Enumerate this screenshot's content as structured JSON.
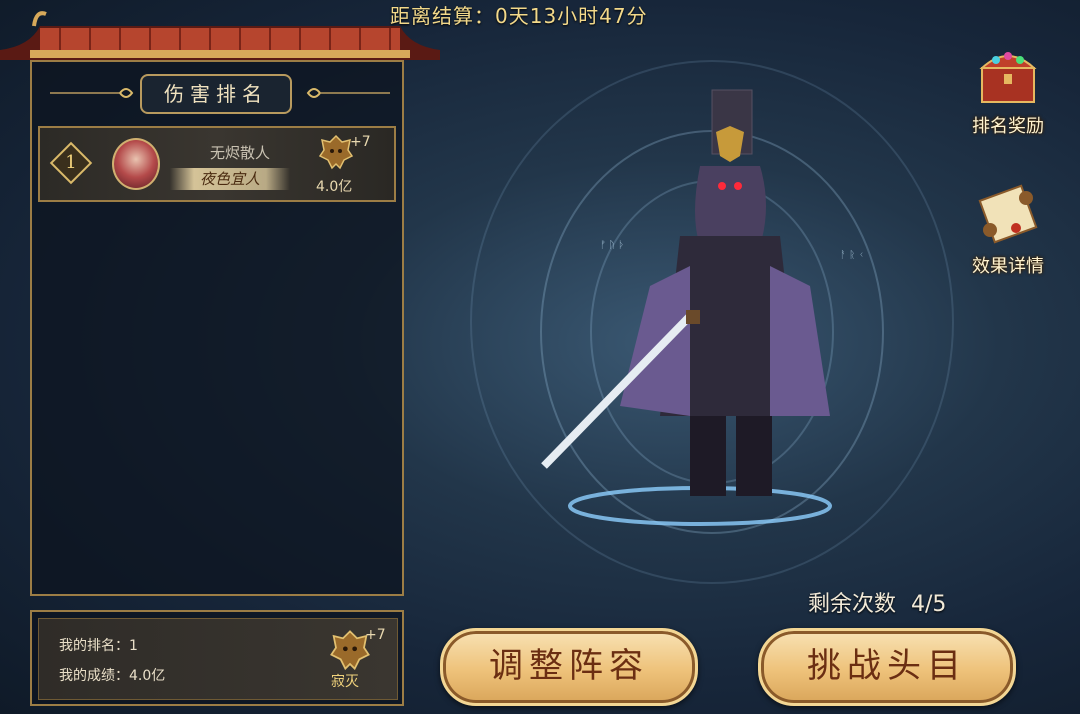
{
  "header": {
    "countdown": "距离结算：0天13小时47分"
  },
  "ranking_panel": {
    "title": "伤害排名",
    "entries": [
      {
        "rank": "1",
        "player_name": "无烬散人",
        "title_tag": "夜色宜人",
        "plus": "+7",
        "score": "4.0亿"
      }
    ]
  },
  "my_stats": {
    "rank_label": "我的排名：",
    "rank_value": "1",
    "score_label": "我的成绩：",
    "score_value": "4.0亿",
    "plus": "+7",
    "badge_text": "寂灭"
  },
  "side_buttons": {
    "ranking_reward": "排名奖励",
    "effect_details": "效果详情"
  },
  "boss": {
    "remaining_label": "剩余次数",
    "remaining_value": "4/5"
  },
  "actions": {
    "adjust_lineup": "调整阵容",
    "challenge_boss": "挑战头目"
  },
  "colors": {
    "accent_gold": "#d9b96a",
    "button_fill": "#eec27a",
    "button_text": "#6b2e12"
  },
  "icons": [
    "treasure-chest-icon",
    "scroll-icon",
    "demon-mask-badge-icon",
    "cloud-ornament-icon"
  ]
}
